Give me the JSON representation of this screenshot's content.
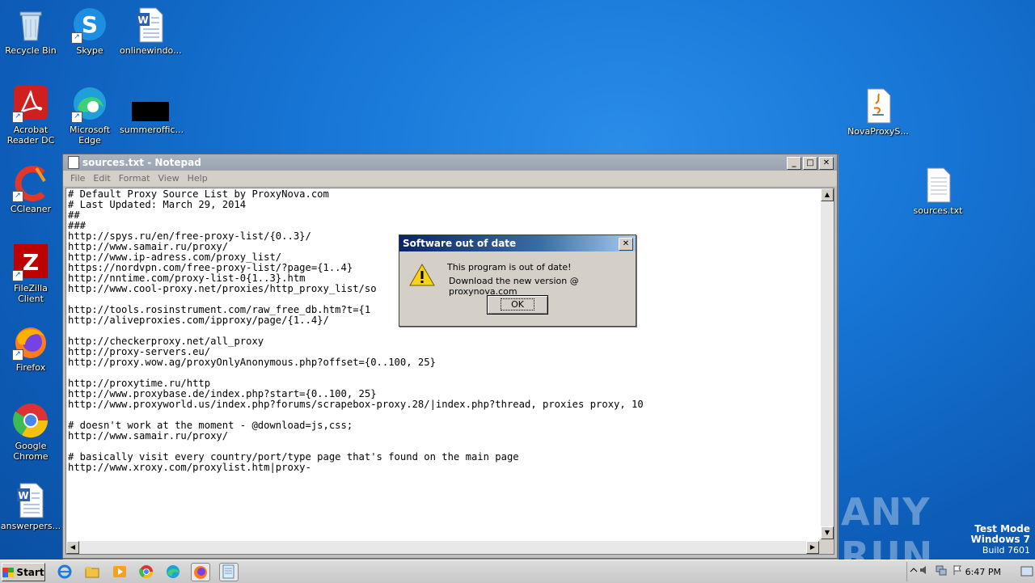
{
  "desktop": {
    "icons_left": [
      {
        "label": "Recycle Bin"
      },
      {
        "label": "Skype"
      },
      {
        "label": "onlinewindo..."
      },
      {
        "label": "Acrobat Reader DC"
      },
      {
        "label": "Microsoft Edge"
      },
      {
        "label": "summeroffic..."
      },
      {
        "label": "CCleaner"
      },
      {
        "label": "FileZilla Client"
      },
      {
        "label": "Firefox"
      },
      {
        "label": "Google Chrome"
      },
      {
        "label": "answerpers..."
      }
    ],
    "icons_right": [
      {
        "label": "NovaProxyS..."
      },
      {
        "label": "sources.txt"
      }
    ]
  },
  "notepad": {
    "title": "sources.txt - Notepad",
    "menu": [
      "File",
      "Edit",
      "Format",
      "View",
      "Help"
    ],
    "lines": [
      "# Default Proxy Source List by ProxyNova.com",
      "# Last Updated: March 29, 2014",
      "##",
      "###",
      "http://spys.ru/en/free-proxy-list/{0..3}/",
      "http://www.samair.ru/proxy/",
      "http://www.ip-adress.com/proxy_list/",
      "https://nordvpn.com/free-proxy-list/?page={1..4}",
      "http://nntime.com/proxy-list-0{1..3}.htm",
      "http://www.cool-proxy.net/proxies/http_proxy_list/so",
      "",
      "http://tools.rosinstrument.com/raw_free_db.htm?t={1",
      "http://aliveproxies.com/ipproxy/page/{1..4}/",
      "",
      "http://checkerproxy.net/all_proxy",
      "http://proxy-servers.eu/",
      "http://proxy.wow.ag/proxyOnlyAnonymous.php?offset={0..100, 25}",
      "",
      "http://proxytime.ru/http",
      "http://www.proxybase.de/index.php?start={0..100, 25}",
      "http://www.proxyworld.us/index.php?forums/scrapebox-proxy.28/|index.php?thread, proxies proxy, 10",
      "",
      "# doesn't work at the moment - @download=js,css;",
      "http://www.samair.ru/proxy/",
      "",
      "# basically visit every country/port/type page that's found on the main page",
      "http://www.xroxy.com/proxylist.htm|proxy-"
    ]
  },
  "dialog": {
    "title": "Software out of date",
    "message_line1": "This program is out of date!",
    "message_line2": "Download the new version @ proxynova.com",
    "ok_label": "OK"
  },
  "watermark": {
    "brand": "ANY RUN",
    "test_mode": "Test Mode",
    "os": "Windows 7",
    "build": "Build 7601"
  },
  "taskbar": {
    "start_label": "Start",
    "clock": "6:47 PM"
  }
}
